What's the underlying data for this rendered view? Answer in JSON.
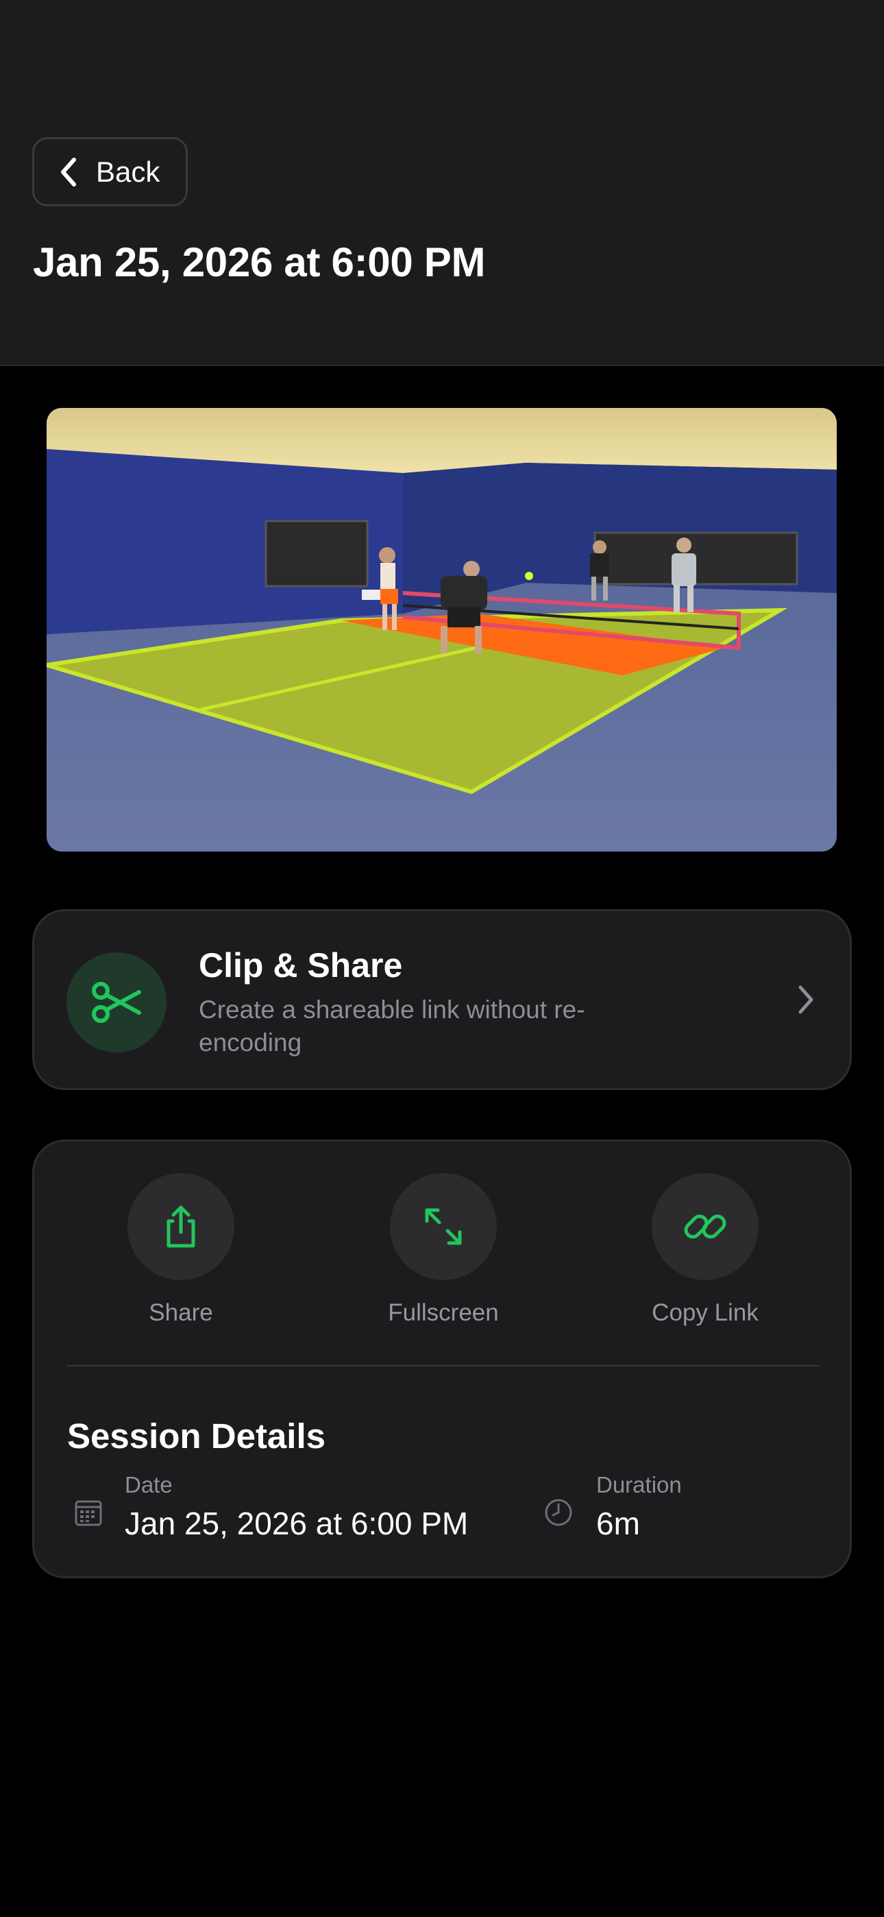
{
  "header": {
    "back_label": "Back",
    "title": "Jan 25, 2026 at 6:00 PM"
  },
  "clip_share": {
    "title": "Clip & Share",
    "subtitle": "Create a shareable link without re-encoding",
    "icon": "scissors-icon"
  },
  "actions": [
    {
      "label": "Share",
      "icon": "share-icon"
    },
    {
      "label": "Fullscreen",
      "icon": "expand-icon"
    },
    {
      "label": "Copy Link",
      "icon": "link-icon"
    }
  ],
  "session_details": {
    "title": "Session Details",
    "date_label": "Date",
    "date_value": "Jan 25, 2026 at 6:00 PM",
    "duration_label": "Duration",
    "duration_value": "6m"
  },
  "colors": {
    "accent": "#22c55e",
    "background": "#000000",
    "card": "#1c1c1e",
    "header": "#1c1c1e"
  }
}
